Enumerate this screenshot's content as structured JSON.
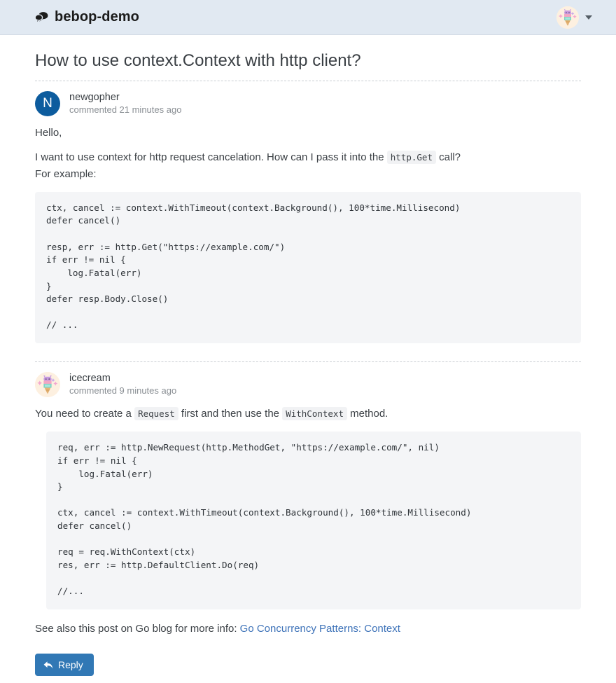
{
  "header": {
    "brand_icon": "comments-icon",
    "brand_title": "bebop-demo",
    "avatar_icon": "ice-cream-avatar",
    "caret_icon": "chevron-down-icon"
  },
  "issue": {
    "title": "How to use context.Context with http client?"
  },
  "comments": [
    {
      "author": "newgopher",
      "avatar_initial": "N",
      "avatar_color": "#0d5c9e",
      "timestamp": "commented 21 minutes ago",
      "paragraph_1": "Hello,",
      "paragraph_2_pre": "I want to use context for http request cancelation. How can I pass it into the ",
      "paragraph_2_code": "http.Get",
      "paragraph_2_post": " call?",
      "paragraph_2_line2": "For example:",
      "code": "ctx, cancel := context.WithTimeout(context.Background(), 100*time.Millisecond)\ndefer cancel()\n\nresp, err := http.Get(\"https://example.com/\")\nif err != nil {\n    log.Fatal(err)\n}\ndefer resp.Body.Close()\n\n// ..."
    },
    {
      "author": "icecream",
      "avatar_icon": "ice-cream-avatar",
      "timestamp": "commented 9 minutes ago",
      "paragraph_1_pre": "You need to create a ",
      "paragraph_1_code_1": "Request",
      "paragraph_1_mid": " first and then use the ",
      "paragraph_1_code_2": "WithContext",
      "paragraph_1_post": " method.",
      "code": "req, err := http.NewRequest(http.MethodGet, \"https://example.com/\", nil)\nif err != nil {\n    log.Fatal(err)\n}\n\nctx, cancel := context.WithTimeout(context.Background(), 100*time.Millisecond)\ndefer cancel()\n\nreq = req.WithContext(ctx)\nres, err := http.DefaultClient.Do(req)\n\n//...",
      "footer_pre": "See also this post on Go blog for more info: ",
      "footer_link": "Go Concurrency Patterns: Context"
    }
  ],
  "actions": {
    "reply_label": "Reply",
    "reply_icon": "reply-arrow-icon",
    "reply_color": "#3178b5"
  }
}
